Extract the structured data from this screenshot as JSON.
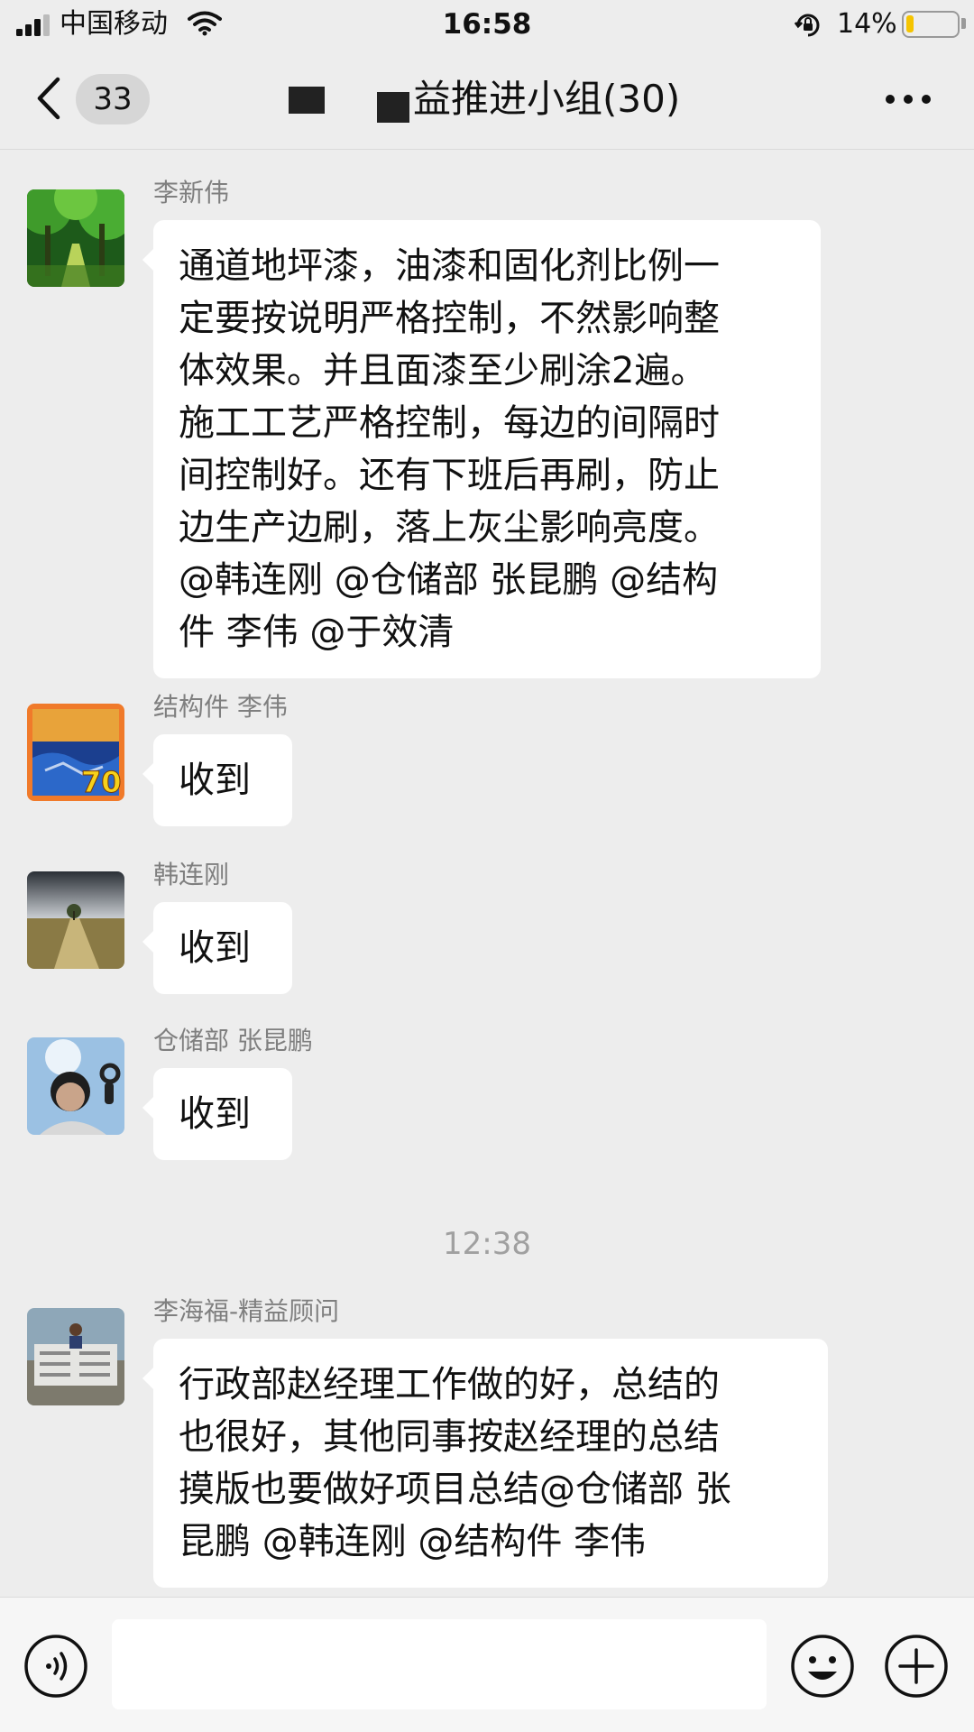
{
  "status_bar": {
    "carrier": "中国移动",
    "time": "16:58",
    "battery_percent_text": "14%",
    "battery_level": 0.14,
    "battery_color": "#f5c400"
  },
  "nav": {
    "back_icon": "chevron-left-icon",
    "unread_count": "33",
    "title": "益推进小组(30)",
    "more_icon": "more-dots-icon"
  },
  "messages": [
    {
      "sender": "李新伟",
      "avatar": "green-forest-avatar",
      "lines": [
        "通道地坪漆，油漆和固化剂比例一",
        "定要按说明严格控制，不然影响整",
        "体效果。并且面漆至少刷涂2遍。",
        "施工工艺严格控制，每边的间隔时",
        "间控制好。还有下班后再刷，防止",
        "边生产边刷，落上灰尘影响亮度。",
        "@韩连刚 @仓储部 张昆鹏 @结构",
        "件 李伟 @于效清"
      ]
    },
    {
      "sender": "结构件 李伟",
      "avatar": "anniversary-70-avatar",
      "avatar_text": "70",
      "lines": [
        "收到"
      ]
    },
    {
      "sender": "韩连刚",
      "avatar": "field-road-avatar",
      "lines": [
        "收到"
      ]
    },
    {
      "sender": "仓储部 张昆鹏",
      "avatar": "ok-hand-person-avatar",
      "lines": [
        "收到"
      ]
    },
    {
      "sender": "李海福-精益顾问",
      "avatar": "person-with-banner-avatar",
      "lines": [
        "行政部赵经理工作做的好，总结的",
        "也很好，其他同事按赵经理的总结",
        "摸版也要做好项目总结@仓储部 张",
        "昆鹏 @韩连刚 @结构件 李伟"
      ]
    }
  ],
  "time_divider": "12:38",
  "input_bar": {
    "voice_icon": "voice-icon",
    "emoji_icon": "emoji-icon",
    "plus_icon": "plus-icon"
  }
}
